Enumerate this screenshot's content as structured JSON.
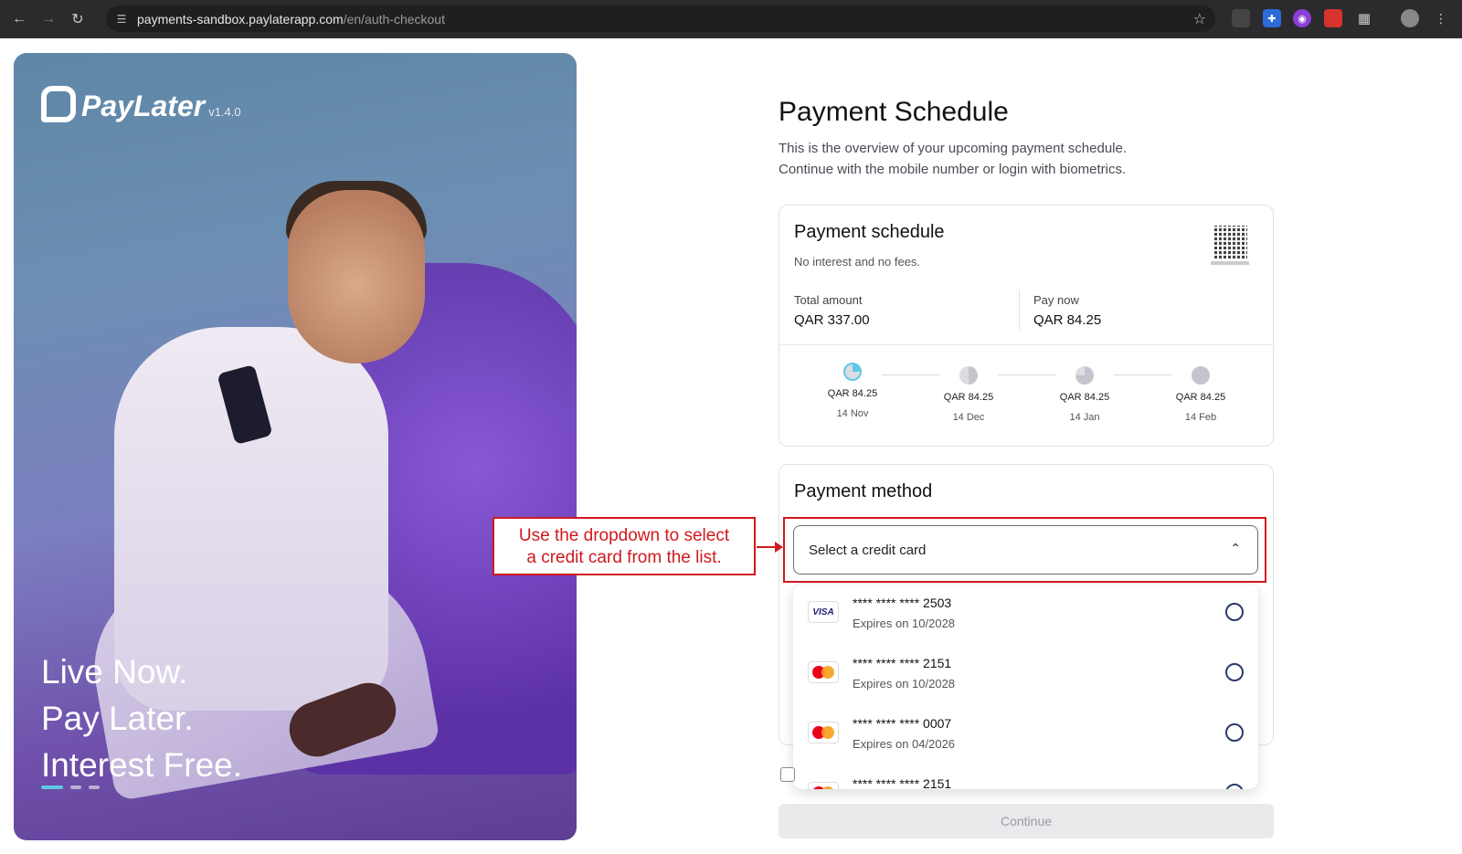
{
  "browser": {
    "url_host": "payments-sandbox.paylaterapp.com",
    "url_path": "/en/auth-checkout",
    "back_icon": "arrow-left-icon",
    "forward_icon": "arrow-right-icon",
    "reload_icon": "reload-icon"
  },
  "hero": {
    "logo_text": "PayLater",
    "version": "v1.4.0",
    "tagline": [
      "Live Now.",
      "Pay Later.",
      "Interest Free."
    ]
  },
  "page": {
    "title": "Payment Schedule",
    "subtitle_line1": "This is the overview of your upcoming payment schedule.",
    "subtitle_line2": "Continue with the mobile number or login with biometrics."
  },
  "schedule": {
    "title": "Payment schedule",
    "subtitle": "No interest and no fees.",
    "total_label": "Total amount",
    "total_value": "QAR 337.00",
    "paynow_label": "Pay now",
    "paynow_value": "QAR 84.25",
    "installments": [
      {
        "amount": "QAR 84.25",
        "date": "14 Nov",
        "fraction": 0.25
      },
      {
        "amount": "QAR 84.25",
        "date": "14 Dec",
        "fraction": 0.5
      },
      {
        "amount": "QAR 84.25",
        "date": "14 Jan",
        "fraction": 0.75
      },
      {
        "amount": "QAR 84.25",
        "date": "14 Feb",
        "fraction": 1.0
      }
    ]
  },
  "method": {
    "title": "Payment method",
    "select_placeholder": "Select a credit card",
    "cards": [
      {
        "brand": "visa",
        "brand_label": "VISA",
        "number": "**** **** **** 2503",
        "expiry": "Expires on 10/2028"
      },
      {
        "brand": "mastercard",
        "number": "**** **** **** 2151",
        "expiry": "Expires on 10/2028"
      },
      {
        "brand": "mastercard",
        "number": "**** **** **** 0007",
        "expiry": "Expires on 04/2026"
      },
      {
        "brand": "mastercard",
        "number": "**** **** **** 2151",
        "expiry": ""
      }
    ]
  },
  "actions": {
    "continue_label": "Continue"
  },
  "annotation": {
    "line1": "Use the dropdown to select",
    "line2": "a credit card from the list."
  },
  "colors": {
    "accent": "#5ec8e6",
    "annotation": "#d0191f",
    "pie_fill": "#5ec8e6",
    "pie_empty": "#dcdce2"
  }
}
